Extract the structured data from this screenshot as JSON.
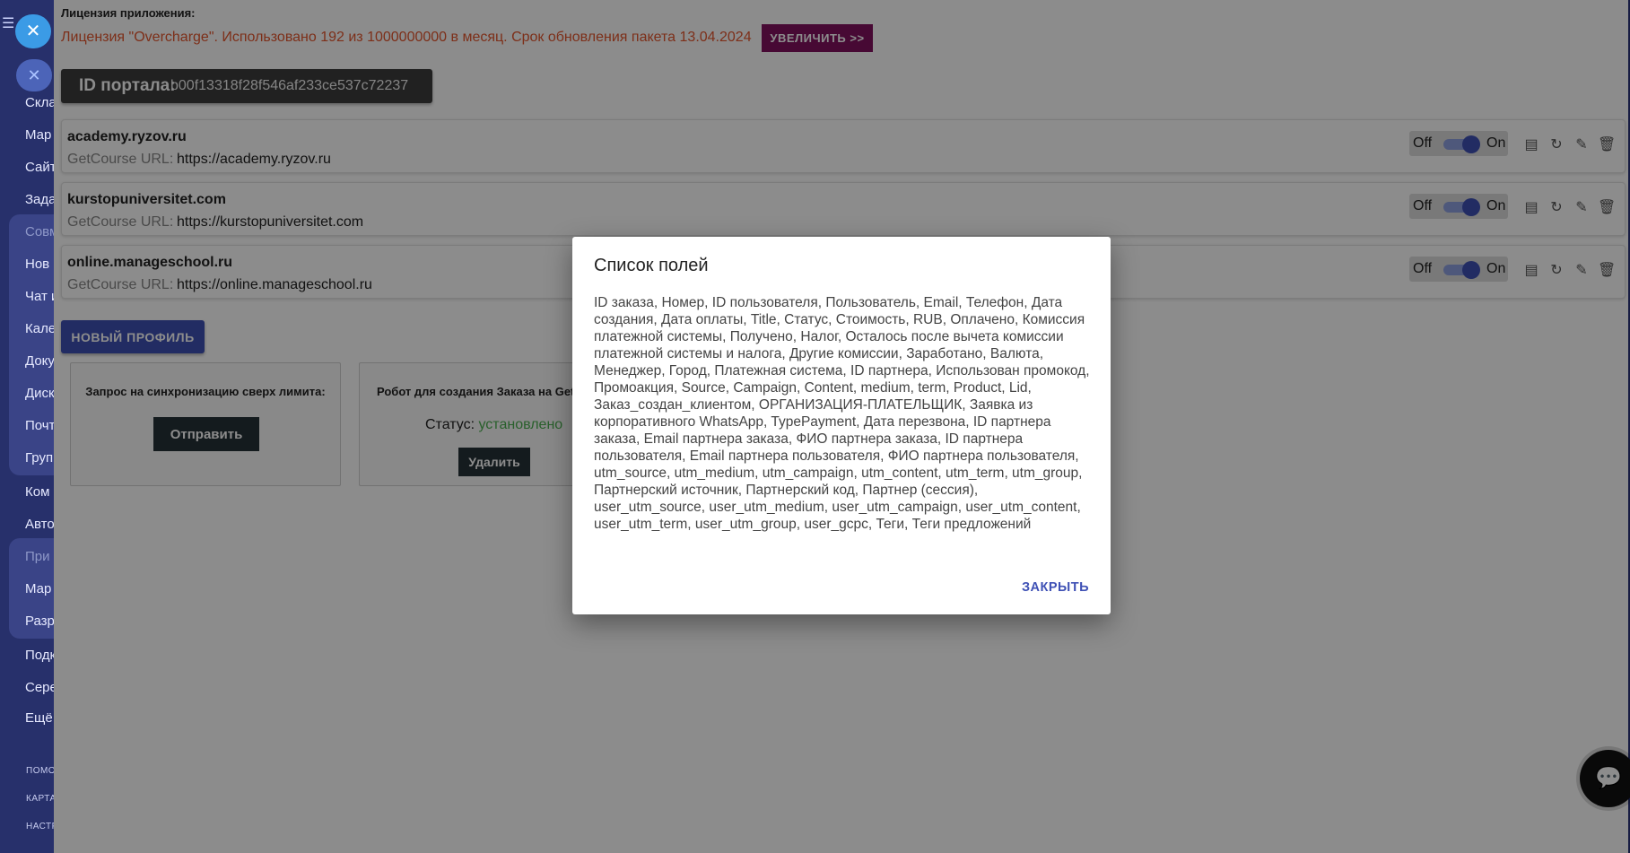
{
  "sidebar": {
    "items": [
      "Скла",
      "Мар",
      "Сайт",
      "Зада",
      "Совм",
      "Нов",
      "Чат и",
      "Кале",
      "Доку",
      "Диск",
      "Почт",
      "Груп",
      "Ком",
      "Авто",
      "При",
      "Мар",
      "Разр",
      "Подк",
      "Сере",
      "Ещё"
    ],
    "small_items": [
      "ПОМО",
      "КАРТА",
      "НАСТР"
    ]
  },
  "license": {
    "label": "Лицензия приложения:",
    "text": "Лицензия \"Overcharge\". Использовано 192 из 1000000000 в месяц. Срок обновления пакета 13.04.2024",
    "increase_button": "УВЕЛИЧИТЬ >>"
  },
  "portal": {
    "label": "ID портала:",
    "value": "b00f13318f28f546af233ce537c72237"
  },
  "profiles": [
    {
      "host": "academy.ryzov.ru",
      "url_label": "GetCourse URL:",
      "url": "https://academy.ryzov.ru",
      "off": "Off",
      "on": "On"
    },
    {
      "host": "kurstopuniversitet.com",
      "url_label": "GetCourse URL:",
      "url": "https://kurstopuniversitet.com",
      "off": "Off",
      "on": "On"
    },
    {
      "host": "online.manageschool.ru",
      "url_label": "GetCourse URL:",
      "url": "https://online.manageschool.ru",
      "off": "Off",
      "on": "On"
    }
  ],
  "new_profile_button": "НОВЫЙ ПРОФИЛЬ",
  "cards": {
    "sync": {
      "title": "Запрос на синхронизацию сверх лимита:",
      "button": "Отправить"
    },
    "robot": {
      "title": "Робот для создания Заказа на Getc",
      "status_label": "Статус:",
      "status_value": "установлено",
      "button": "Удалить"
    }
  },
  "colors": {
    "license_text": "#e4572e",
    "increase_button": "#82125f",
    "primary": "#3f51b5",
    "status_ok": "#4caf50"
  },
  "dialog": {
    "title": "Список полей",
    "body": "ID заказа, Номер, ID пользователя, Пользователь, Email, Телефон, Дата создания, Дата оплаты, Title, Статус, Стоимость, RUB, Оплачено, Комиссия платежной системы, Получено, Налог, Осталось после вычета комиссии платежной системы и налога, Другие комиссии, Заработано, Валюта, Менеджер, Город, Платежная система, ID партнера, Использован промокод, Промоакция, Source, Campaign, Content, medium, term, Product, Lid, Заказ_создан_клиентом, ОРГАНИЗАЦИЯ-ПЛАТЕЛЬЩИК, Заявка из корпоративного WhatsApp, TypePayment, Дата перезвона, ID партнера заказа, Email партнера заказа, ФИО партнера заказа, ID партнера пользователя, Email партнера пользователя, ФИО партнера пользователя, utm_source, utm_medium, utm_campaign, utm_content, utm_term, utm_group, Партнерский источник, Партнерский код, Партнер (сессия), user_utm_source, user_utm_medium, user_utm_campaign, user_utm_content, user_utm_term, user_utm_group, user_gcpc, Теги, Теги предложений",
    "close_button": "ЗАКРЫТЬ"
  },
  "icons": {
    "burger": "☰",
    "close": "✕",
    "list": "▤",
    "sync": "↻",
    "edit": "✎",
    "delete": "🗑",
    "chat": "💬"
  }
}
